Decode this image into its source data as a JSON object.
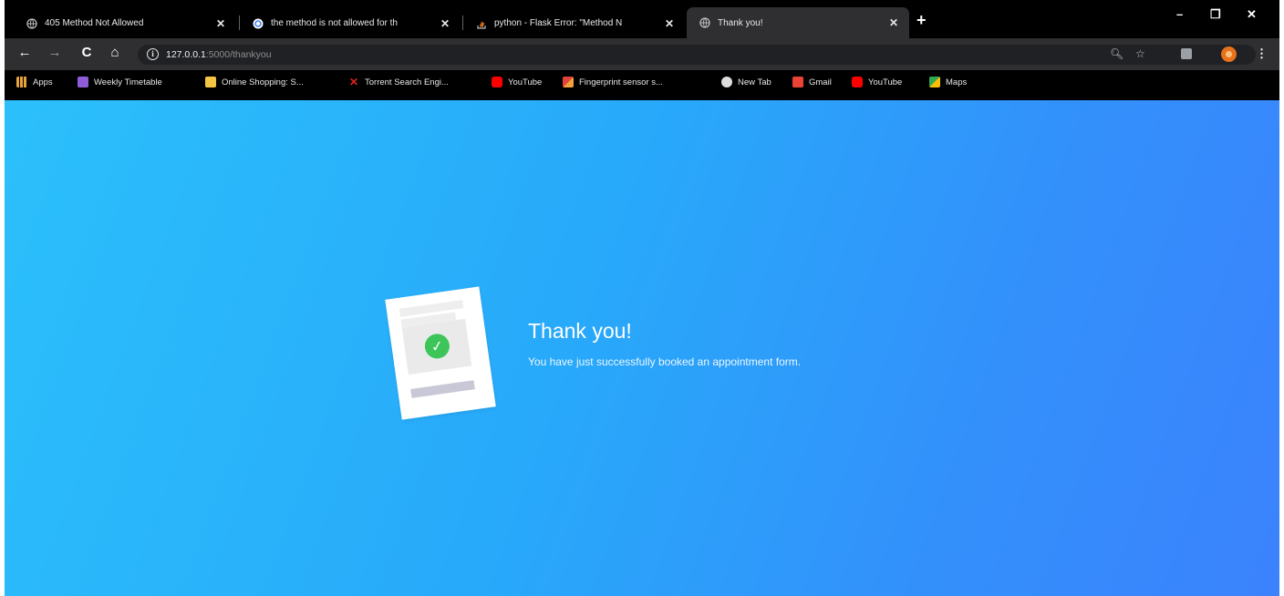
{
  "tabs": [
    {
      "title": "405 Method Not Allowed",
      "active": false
    },
    {
      "title": "the method is not allowed for th",
      "active": false
    },
    {
      "title": "python - Flask Error: \"Method N",
      "active": false
    },
    {
      "title": "Thank you!",
      "active": true
    }
  ],
  "toolbar": {
    "url_host": "127.0.0.1",
    "url_rest": ":5000/thankyou"
  },
  "bookmarks": [
    {
      "label": "Apps",
      "icon": "apps-grid-icon",
      "color": "#e8a33d"
    },
    {
      "label": "Weekly Timetable",
      "icon": "timetable-icon",
      "color": "#8e5cd9"
    },
    {
      "label": "Online Shopping: S...",
      "icon": "shopping-icon",
      "color": "#f4c542"
    },
    {
      "label": "Torrent Search Engi...",
      "icon": "torrent-x-icon",
      "color": "#e02020"
    },
    {
      "label": "YouTube",
      "icon": "youtube-icon",
      "color": "#ff0000"
    },
    {
      "label": "Fingerprint sensor s...",
      "icon": "fingerprint-icon",
      "color": "#e0443a"
    },
    {
      "label": "New Tab",
      "icon": "globe-icon",
      "color": "#dddddd"
    },
    {
      "label": "Gmail",
      "icon": "gmail-icon",
      "color": "#ea4335"
    },
    {
      "label": "YouTube",
      "icon": "youtube-icon",
      "color": "#ff0000"
    },
    {
      "label": "Maps",
      "icon": "maps-icon",
      "color": "#34a853"
    }
  ],
  "page": {
    "heading": "Thank you!",
    "message": "You have just successfully booked an appointment form."
  }
}
